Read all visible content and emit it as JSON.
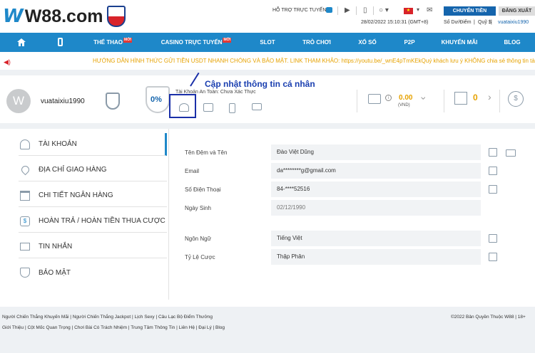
{
  "header": {
    "logo_w": "W",
    "logo_text": "W88.com",
    "support": "HỖ TRỢ TRỰC TUYẾN",
    "login": "CHUYỂN TIỀN",
    "logout": "ĐĂNG XUẤT",
    "datetime": "28/02/2022 15:10:31 (GMT+8)",
    "balance_label": "Số Dư/Điểm",
    "fund_label": "Quỹ $",
    "username": "vuataixiu1990",
    "flag_icon": "vn-flag-icon"
  },
  "nav": {
    "items": [
      {
        "label": "THỂ THAO",
        "hot": "MỚI"
      },
      {
        "label": "CASINO TRỰC TUYẾN",
        "hot": "MỚI"
      },
      {
        "label": "SLOT",
        "hot": ""
      },
      {
        "label": "TRÒ CHƠI",
        "hot": ""
      },
      {
        "label": "XỔ SỐ",
        "hot": ""
      },
      {
        "label": "P2P",
        "hot": ""
      },
      {
        "label": "KHUYẾN MÃI",
        "hot": ""
      },
      {
        "label": "BLOG",
        "hot": ""
      }
    ]
  },
  "ticker": "HƯỚNG DẪN HÌNH THỨC GỬI TIỀN USDT NHANH CHÓNG VÀ BẢO MẬT. LINK THAM KHẢO: https://youtu.be/_wnE4pTmKEkQuý khách lưu ý KHÔNG chia sẻ thông tin tài k",
  "user": {
    "avatar_letter": "W",
    "name": "vuataixiu1990",
    "progress_percent": "0%",
    "verify_label": "Tài Khoản An Toàn: Chưa Xác Thực",
    "balance": "0.00",
    "currency": "(VND)",
    "gift_count": "0"
  },
  "callout": "Cập nhật thông tin cá nhân",
  "sidebar": {
    "items": [
      {
        "label": "TÀI KHOẢN",
        "icon": "user-icon"
      },
      {
        "label": "ĐỊA CHỈ GIAO HÀNG",
        "icon": "location-icon"
      },
      {
        "label": "CHI TIẾT NGÂN HÀNG",
        "icon": "bank-icon"
      },
      {
        "label": "HOÀN TRẢ / HOÀN TIỀN THUA CƯỢC",
        "icon": "rebate-icon"
      },
      {
        "label": "TIN NHẮN",
        "icon": "mail-icon"
      },
      {
        "label": "BẢO MẬT",
        "icon": "shield-icon"
      }
    ]
  },
  "form": {
    "fullname_label": "Tên Đệm và Tên",
    "fullname_value": "Đào Việt Dũng",
    "email_label": "Email",
    "email_value": "da********g@gmail.com",
    "phone_label": "Số Điện Thoại",
    "phone_value": "84-****52516",
    "dob_label": "Ngày Sinh",
    "dob_value": "02/12/1990",
    "lang_label": "Ngôn Ngữ",
    "lang_value": "Tiếng Việt",
    "odds_label": "Tỷ Lệ Cược",
    "odds_value": "Thập Phân"
  },
  "footer": {
    "row1": "Người Chiến Thắng Khuyến Mãi | Người Chiến Thắng Jackpot | Lịch Sexy | Câu Lạc Bộ Điểm Thưởng",
    "row2": "Giới Thiệu | Cột Mốc Quan Trọng | Chơi Bài Có Trách Nhiệm | Trung Tâm Thông Tin | Liên Hệ | Đại Lý | Blog",
    "copyright": "©2022 Bản Quyền Thuộc W88 | 18+"
  }
}
